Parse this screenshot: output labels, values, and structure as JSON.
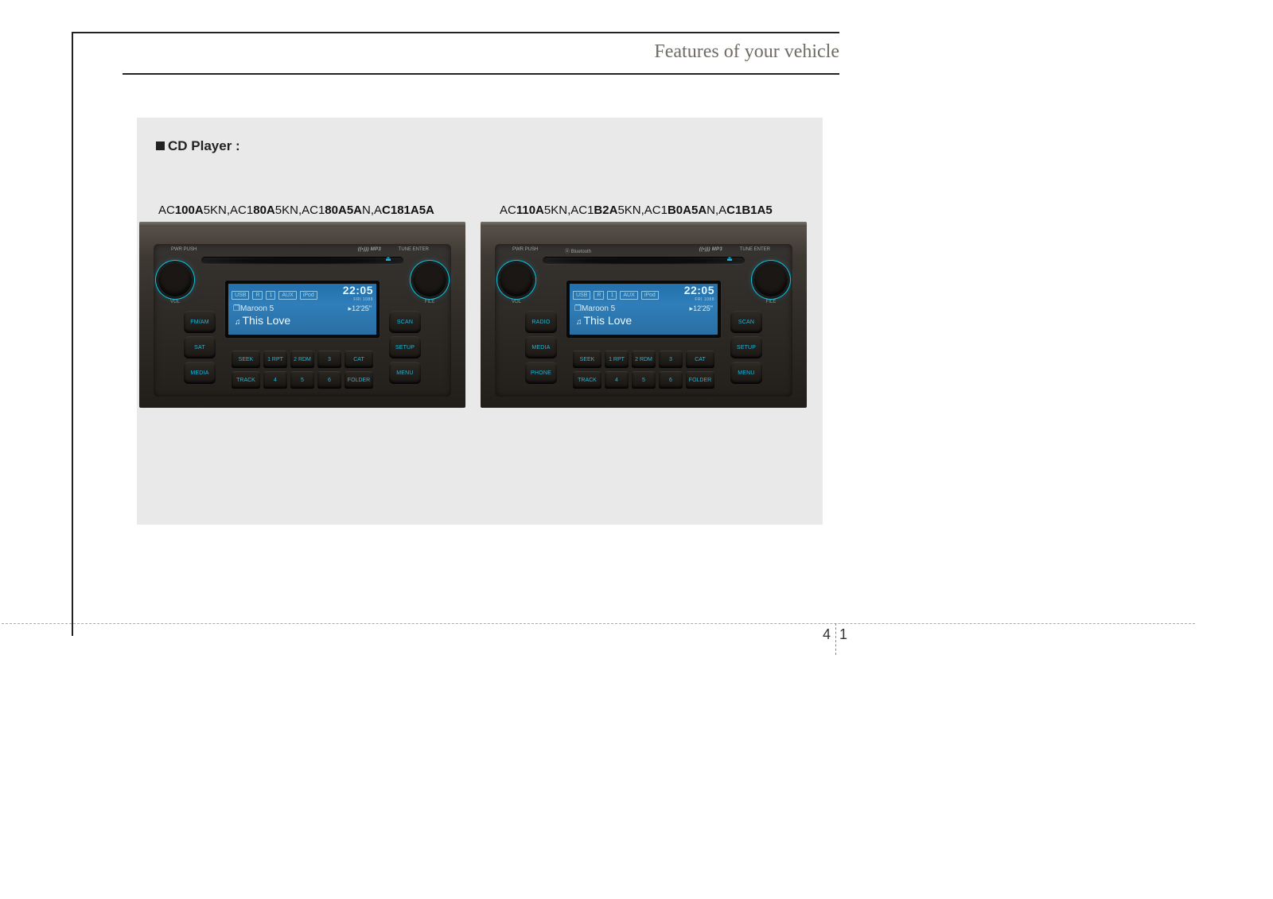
{
  "header": {
    "section_title": "Features of your vehicle"
  },
  "figure": {
    "label": "CD Player :"
  },
  "units": {
    "left": {
      "models": "AC<b>100A</b>5KN,AC1<b>80A</b>5KN,AC1<b>80A5A</b>N,A<b>C181A5A</b>",
      "has_bluetooth": false,
      "side_buttons_left": [
        "FM/AM",
        "SAT",
        "MEDIA"
      ],
      "side_buttons_right": [
        "SCAN",
        "SETUP",
        "MENU"
      ]
    },
    "right": {
      "models": "AC<b>110A</b>5KN,AC1<b>B2A</b>5KN,AC1<b>B0A5A</b>N,A<b>C1B1A5</b>",
      "has_bluetooth": true,
      "side_buttons_left": [
        "RADIO",
        "MEDIA",
        "PHONE"
      ],
      "side_buttons_right": [
        "SCAN",
        "SETUP",
        "MENU"
      ]
    }
  },
  "top_labels": {
    "pwr": "PWR\nPUSH",
    "mp3": "((•))) MP3",
    "tune": "TUNE  ENTER",
    "bt": "Bluetooth"
  },
  "knob_captions": {
    "vol": "VOL",
    "file": "FILE"
  },
  "lcd": {
    "source": "USB",
    "icons": [
      "R",
      "1",
      "AUX",
      "iPod"
    ],
    "clock": "22:05",
    "clock_sub": "FRI  1088",
    "folder_icon": "❐",
    "folder": "Maroon 5",
    "elapsed": "▸12'25\"",
    "note": "♫",
    "track": "This Love"
  },
  "presets": {
    "row_a": [
      "SEEK",
      "1 RPT",
      "2 RDM",
      "3",
      "CAT"
    ],
    "row_b": [
      "TRACK",
      "4",
      "5",
      "6",
      "FOLDER"
    ]
  },
  "page": {
    "section": "4",
    "num": "1"
  }
}
